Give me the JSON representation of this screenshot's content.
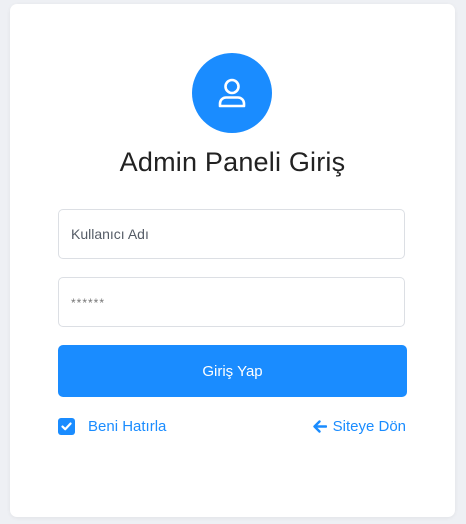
{
  "colors": {
    "accent": "#1a8cff",
    "background": "#eef0f4",
    "card": "#ffffff"
  },
  "header": {
    "icon": "user-icon",
    "title": "Admin Paneli Giriş"
  },
  "form": {
    "username_placeholder": "Kullanıcı Adı",
    "password_placeholder": "******",
    "submit_label": "Giriş Yap"
  },
  "footer": {
    "remember_label": "Beni Hatırla",
    "remember_checked": true,
    "back_icon": "arrow-left-icon",
    "back_label": "Siteye Dön"
  }
}
